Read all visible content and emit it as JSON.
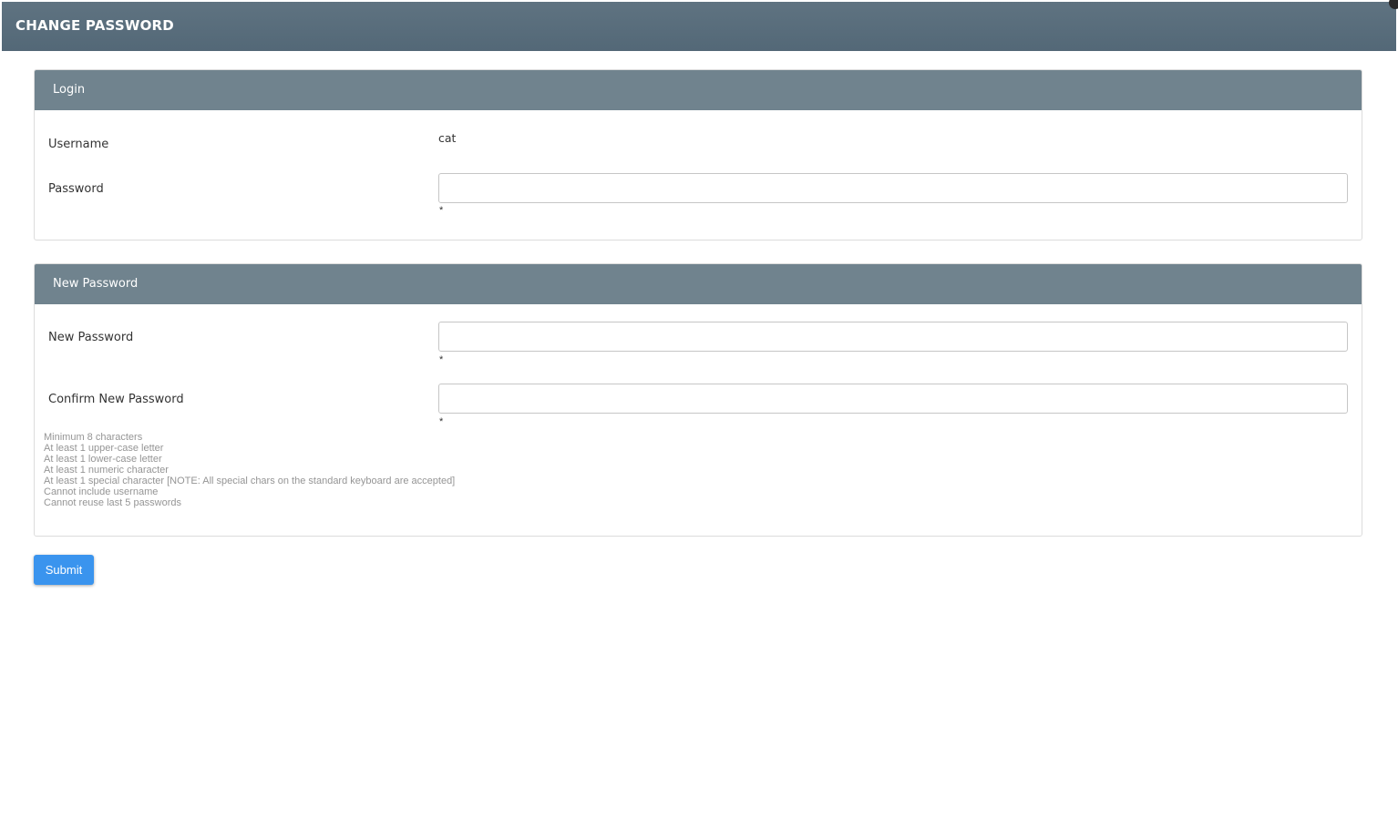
{
  "header": {
    "title": "CHANGE PASSWORD"
  },
  "login_panel": {
    "heading": "Login",
    "username_label": "Username",
    "username_value": "cat",
    "password_label": "Password",
    "password_value": "",
    "password_required_mark": "*"
  },
  "new_password_panel": {
    "heading": "New Password",
    "new_password_label": "New Password",
    "new_password_value": "",
    "new_password_required_mark": "*",
    "confirm_label": "Confirm New Password",
    "confirm_value": "",
    "confirm_required_mark": "*",
    "rules": [
      "Minimum 8 characters",
      "At least 1 upper-case letter",
      "At least 1 lower-case letter",
      "At least 1 numeric character",
      "At least 1 special character [NOTE: All special chars on the standard keyboard are accepted]",
      "Cannot include username",
      "Cannot reuse last 5 passwords"
    ]
  },
  "actions": {
    "submit_label": "Submit"
  },
  "colors": {
    "header_bg": "#596e7c",
    "panel_heading_bg": "#70838e",
    "submit_bg": "#3a94ee",
    "rules_text": "#959595"
  }
}
